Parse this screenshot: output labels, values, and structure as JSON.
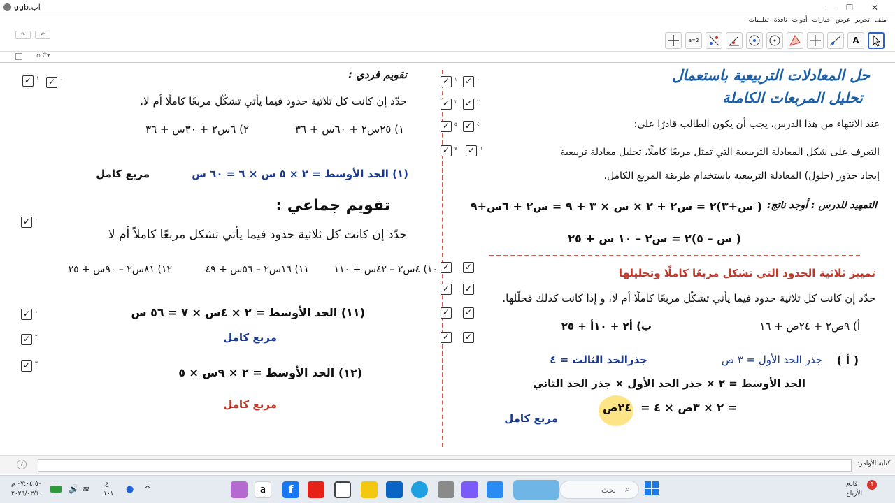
{
  "window": {
    "title": "ggb.اب",
    "minimize": "—",
    "maximize": "☐",
    "close": "✕"
  },
  "menu": [
    "ملف",
    "تحرير",
    "عرض",
    "خيارات",
    "أدوات",
    "نافذة",
    "تعليمات"
  ],
  "toolbar": {
    "text_tool": "A",
    "slider_tool": "a=2"
  },
  "right": {
    "title1": "حل المعادلات التربيعية باستعمال",
    "title2": "تحليل المربعات الكاملة",
    "intro": "عند الانتهاء من هذا الدرس، يجب أن يكون الطالب قادرًا على:",
    "obj1": "التعرف على شكل المعادلة التربيعية التي تمثل مربعًا كاملًا، تحليل معادلة تربيعية",
    "obj2": "إيجاد جذور (حلول) المعادلة التربيعية باستخدام طريقة المربع الكامل.",
    "prep_label": "التمهيد للدرس : أوجد ناتج:",
    "eq1": "( س+٣)٢ = س٢ + ٢ × س × ٣ + ٩ = س٢ + ٦س+٩",
    "eq2": "( س – ٥)٢ = س٢ – ١٠ س + ٢٥",
    "sub_title": "تمييز ثلاثية الحدود التي تشكل مربعًا كاملًا وتحليلها",
    "question": "حدّد إن كانت كل ثلاثية حدود فيما يأتي تشكّل مربعًا كاملًا أم لا، و إذا كانت كذلك فحلّلها.",
    "qa": "أ) ٩ص٢ + ٢٤ص + ١٦",
    "qb": "ب) أ٢ + ١٠أ + ٢٥",
    "a_label": "( أ )",
    "root1": "جذر الحد الأول = ٣ ص",
    "root3": "جذرالحد الثالث = ٤",
    "middle_rule": "الحد الأوسط = ٢ × جذر الحد الأول × جذر الحد الثاني",
    "middle_calc": "= ٢ × ٣ص × ٤ =",
    "middle_result": "٢٤ص",
    "perfect": "مربع كامل"
  },
  "left": {
    "individual": "تقويم فردي :",
    "question": "حدّد إن كانت كل ثلاثية حدود فيما يأتي تشكّل مربعًا كاملًا أم لا.",
    "q1": "١) ٢٥س٢ + ٦٠س + ٣٦",
    "q2": "٢) ٦س٢ + ٣٠س + ٣٦",
    "ans1": "(١) الحد الأوسط = ٢ × ٥ س × ٦ = ٦٠ س",
    "perfect1": "مربع كامل",
    "group": "تقويم جماعي :",
    "question2": "حدّد إن كانت كل ثلاثية حدود فيما يأتي تشكل مربعًا كاملاً أم لا",
    "q10": "١٠) ٤س٢ – ٤٢س + ١١٠",
    "q11": "١١) ١٦س٢ – ٥٦س + ٤٩",
    "q12": "١٢) ٨١س٢ – ٩٠س + ٢٥",
    "ans11": "(١١) الحد الأوسط = ٢ × ٤س × ٧ = ٥٦ س",
    "perfect11": "مربع كامل",
    "ans12": "(١٢) الحد الأوسط = ٢ × ٩س × ٥",
    "perfect12": "مربع كامل"
  },
  "checkbox_labels": {
    "r1a": "١",
    "r1b": "٠",
    "r2a": "٣",
    "r2b": "٢",
    "r3a": "٥",
    "r3b": "٤",
    "r4a": "٧",
    "r4b": "٦",
    "l1a": "١",
    "l1b": "٠",
    "l2": "٠",
    "l3": "١",
    "l4": "٢",
    "l5": "٣"
  },
  "input_label": "كتابة الأوامر:",
  "taskbar": {
    "search": "بحث",
    "weather1": "قادم",
    "weather2": "الأرباح",
    "time": "٠٧:٠٤:٥٠ م",
    "date": "٢٠٢٦/٠٣/١٠",
    "lang1": "ع",
    "lang2": "١٠١",
    "notif": "1"
  },
  "colors": {
    "title_blue": "#1a5fa8",
    "answer_blue": "#1a3a8f",
    "red": "#c0392b",
    "highlight": "#fde27a",
    "divider": "#d9534f"
  }
}
